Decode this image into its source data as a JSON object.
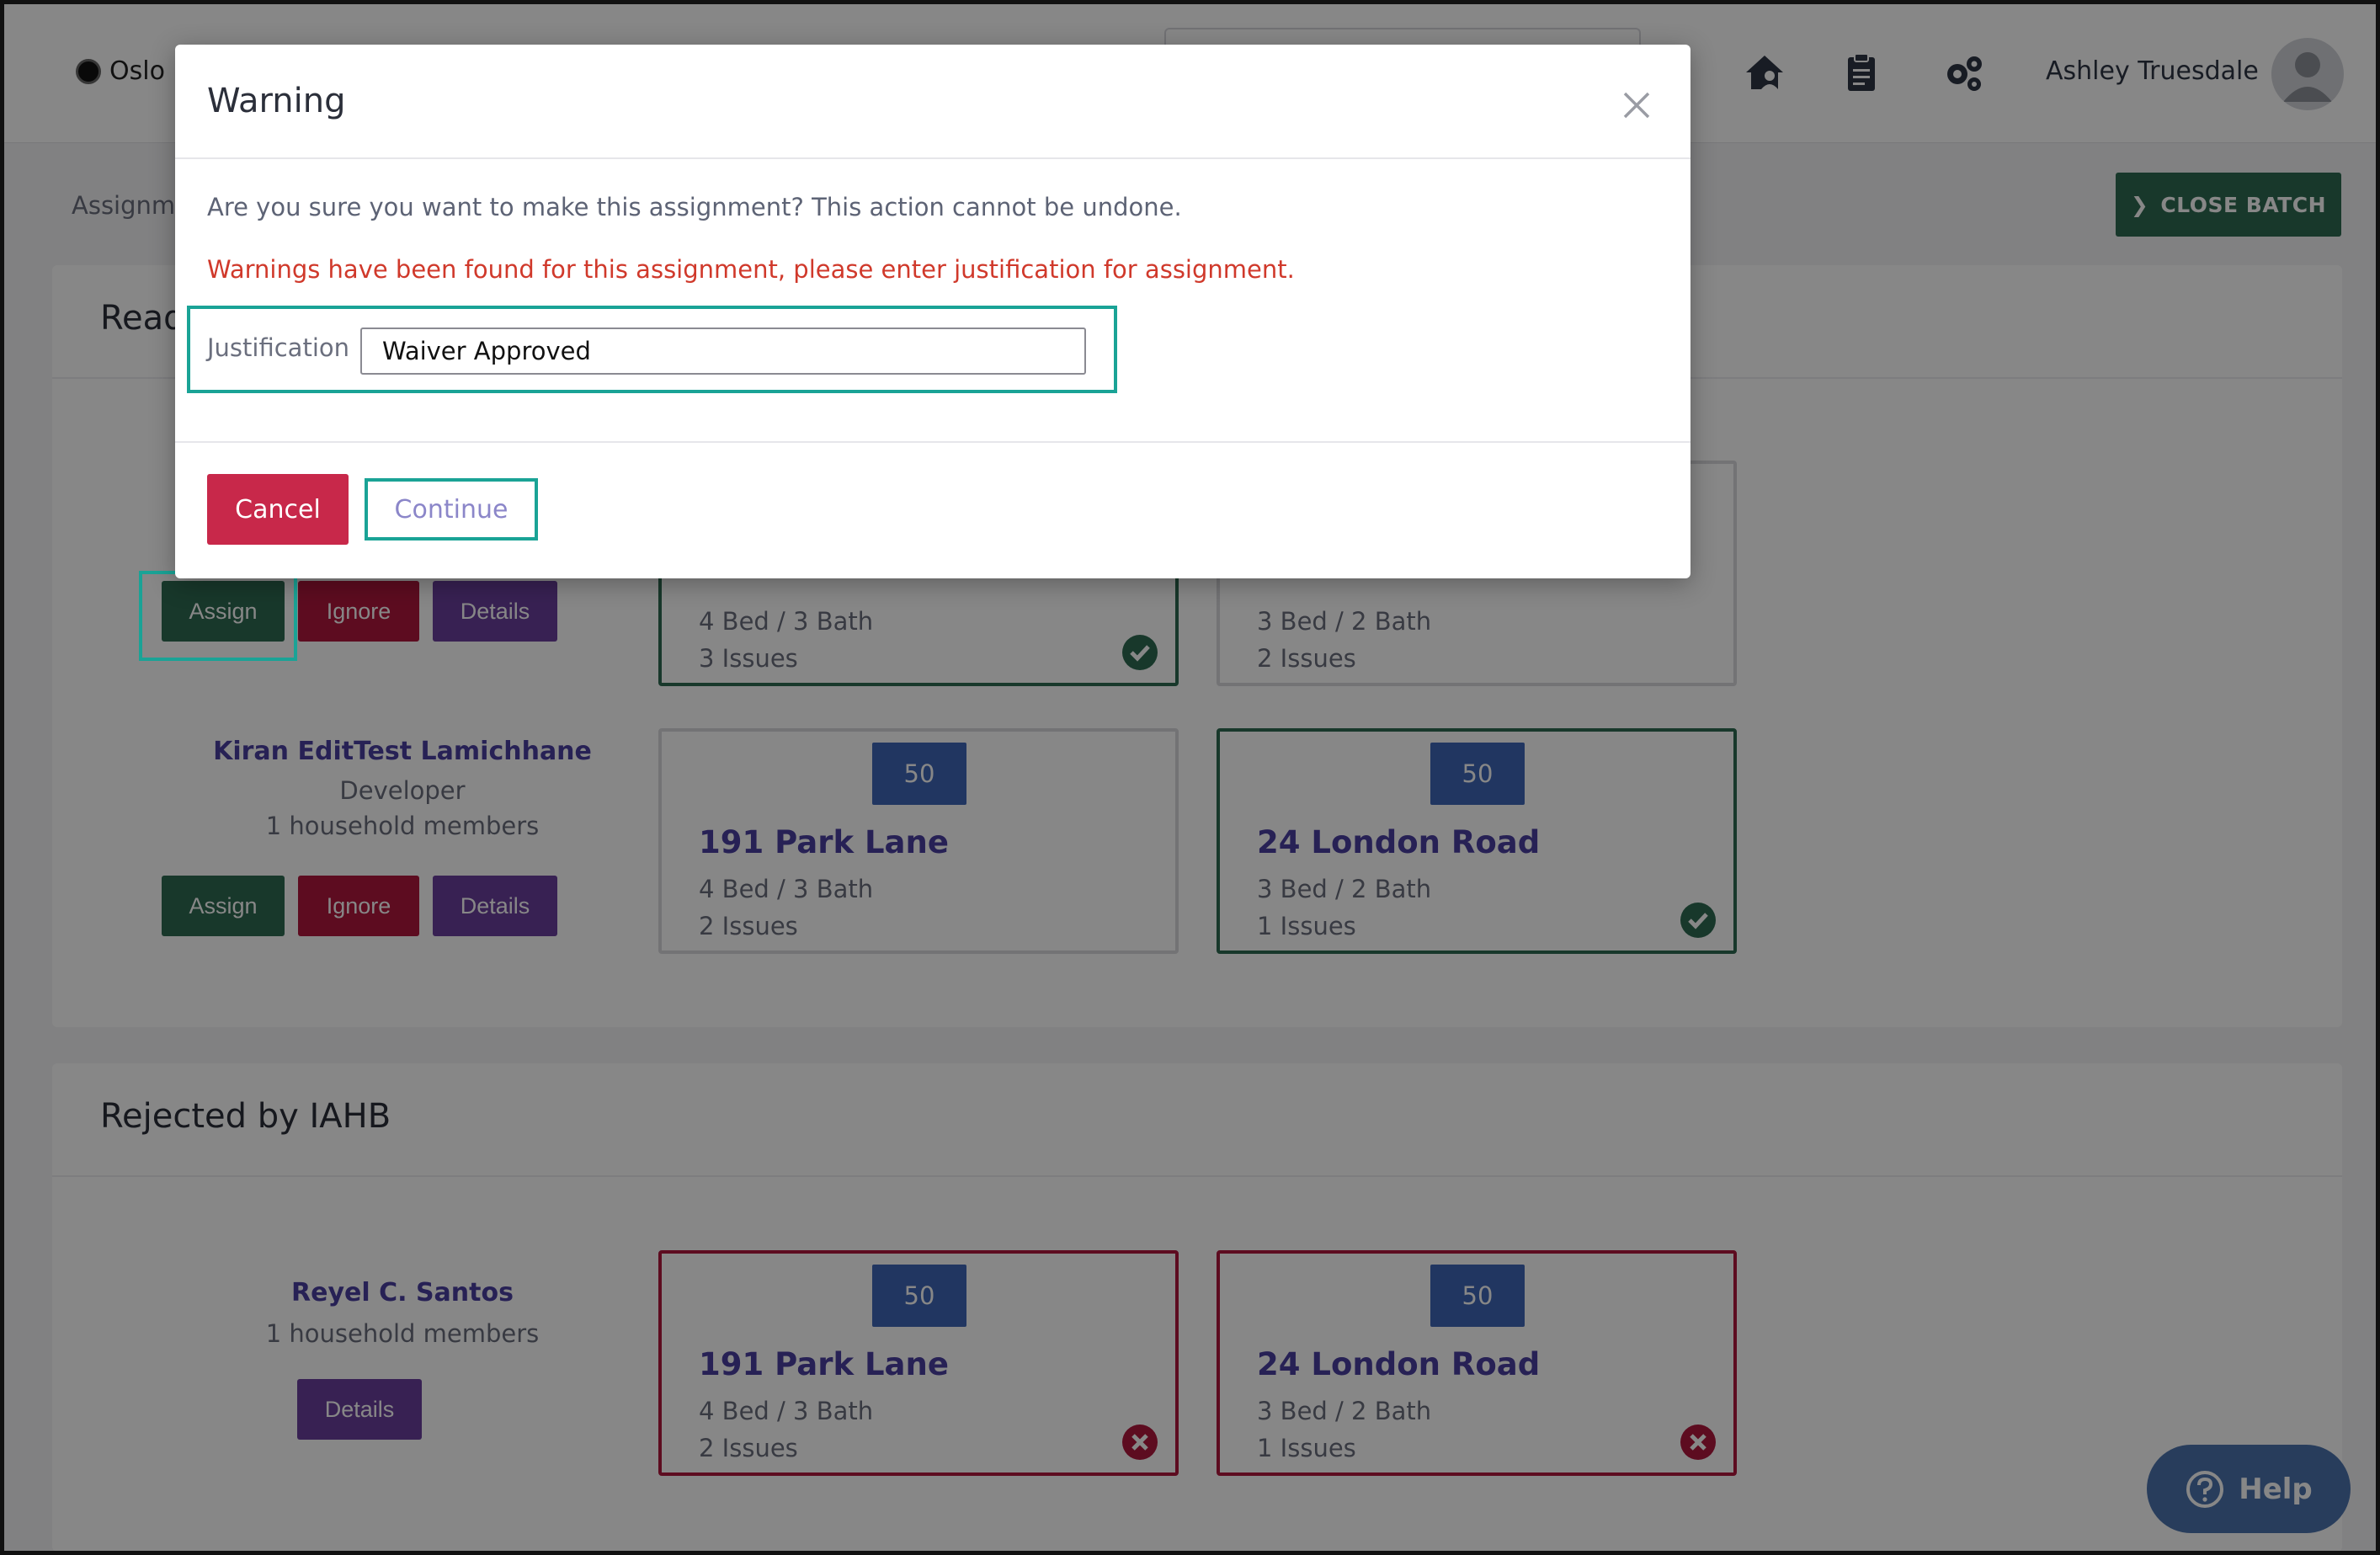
{
  "topbar": {
    "org_name": "Oslo",
    "user_name": "Ashley Truesdale",
    "icons": [
      "house-user-icon",
      "clipboard-icon",
      "gears-icon",
      "user-avatar-icon"
    ]
  },
  "subheader": {
    "breadcrumb": "Assignm",
    "close_batch_label": "CLOSE BATCH"
  },
  "ready_panel": {
    "title": "Read",
    "applicants": [
      {
        "name": "",
        "role": "",
        "household": "",
        "buttons": {
          "assign": "Assign",
          "ignore": "Ignore",
          "details": "Details"
        },
        "units": [
          {
            "badge": "",
            "address": "",
            "beds": "4 Bed / 3 Bath",
            "issues": "3 Issues",
            "status": "matched"
          },
          {
            "badge": "",
            "address": "",
            "beds": "3 Bed / 2 Bath",
            "issues": "2 Issues",
            "status": "none"
          }
        ]
      },
      {
        "name": "Kiran EditTest Lamichhane",
        "role": "Developer",
        "household": "1 household members",
        "buttons": {
          "assign": "Assign",
          "ignore": "Ignore",
          "details": "Details"
        },
        "units": [
          {
            "badge": "50",
            "address": "191 Park Lane",
            "beds": "4 Bed / 3 Bath",
            "issues": "2 Issues",
            "status": "none"
          },
          {
            "badge": "50",
            "address": "24 London Road",
            "beds": "3 Bed / 2 Bath",
            "issues": "1 Issues",
            "status": "matched"
          }
        ]
      }
    ]
  },
  "rejected_panel": {
    "title": "Rejected by IAHB",
    "applicant": {
      "name": "Reyel C. Santos",
      "household": "1 household members",
      "details_label": "Details",
      "units": [
        {
          "badge": "50",
          "address": "191 Park Lane",
          "beds": "4 Bed / 3 Bath",
          "issues": "2 Issues",
          "status": "rejected"
        },
        {
          "badge": "50",
          "address": "24 London Road",
          "beds": "3 Bed / 2 Bath",
          "issues": "1 Issues",
          "status": "rejected"
        }
      ]
    }
  },
  "modal": {
    "title": "Warning",
    "confirm_text": "Are you sure you want to make this assignment? This action cannot be undone.",
    "warning_text": "Warnings have been found for this assignment, please enter justification for assignment.",
    "justification_label": "Justification",
    "justification_value": "Waiver Approved",
    "cancel_label": "Cancel",
    "continue_label": "Continue"
  },
  "help": {
    "label": "Help"
  },
  "colors": {
    "accent_green": "#2e6b52",
    "ignore_red": "#b0173e",
    "details_purple": "#6a3f9d",
    "badge_blue": "#3f67b7",
    "highlight_teal": "#1aa396",
    "warning_red": "#d0392b"
  }
}
